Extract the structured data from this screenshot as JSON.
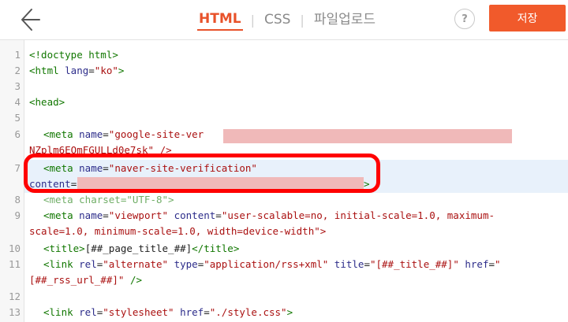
{
  "header": {
    "tabs": [
      {
        "label": "HTML"
      },
      {
        "label": "CSS"
      },
      {
        "label": "파일업로드"
      }
    ],
    "help_label": "?",
    "save_label": "저장"
  },
  "editor": {
    "line_numbers": [
      "1",
      "2",
      "3",
      "4",
      "5",
      "6",
      "7",
      "8",
      "9",
      "10",
      "11",
      "12",
      "13"
    ],
    "line1": "<!doctype html>",
    "line2_a": "<html ",
    "line2_b": "lang",
    "line2_c": "=",
    "line2_d": "\"ko\"",
    "line2_e": ">",
    "line4": "<head>",
    "line6_a": "<meta ",
    "line6_b": "name",
    "line6_c": "=",
    "line6_d": "\"google-site-ver",
    "line6_cont": "NZplm6EOmFGULLd0e7sk\" />",
    "line7_a": "<meta ",
    "line7_b": "name",
    "line7_c": "=",
    "line7_d": "\"naver-site-verification\"",
    "line7_cont_a": "content",
    "line7_cont_b": "=",
    "line7_cont_c": ">",
    "line8": "<meta charset=\"UTF-8\">",
    "line9_a": "<meta ",
    "line9_b": "name",
    "line9_c": "=",
    "line9_d": "\"viewport\"",
    "line9_e": " content",
    "line9_f": "=",
    "line9_g": "\"user-scalable=no, initial-scale=1.0, maximum-",
    "line9_cont": "scale=1.0, minimum-scale=1.0, width=device-width\">",
    "line10_a": "<title>",
    "line10_b": "[##_page_title_##]",
    "line10_c": "</title>",
    "line11_a": "<link ",
    "line11_b": "rel",
    "line11_c": "=",
    "line11_d": "\"alternate\"",
    "line11_e": " type",
    "line11_f": "=",
    "line11_g": "\"application/rss+xml\"",
    "line11_h": " title",
    "line11_i": "=",
    "line11_j": "\"[##_title_##]\"",
    "line11_k": " href",
    "line11_l": "=",
    "line11_m": "\"",
    "line11_cont_a": "[##_rss_url_##]\"",
    "line11_cont_b": " />",
    "line13_a": "<link ",
    "line13_b": "rel",
    "line13_c": "=",
    "line13_d": "\"stylesheet\"",
    "line13_e": " href",
    "line13_f": "=",
    "line13_g": "\"./style.css\"",
    "line13_h": ">"
  },
  "colors": {
    "accent": "#f15a2b",
    "highlight_ring": "#ff0000",
    "redaction": "#f0b9b9"
  },
  "icons": {
    "back": "arrow-left-icon",
    "help": "question-circle-icon"
  }
}
